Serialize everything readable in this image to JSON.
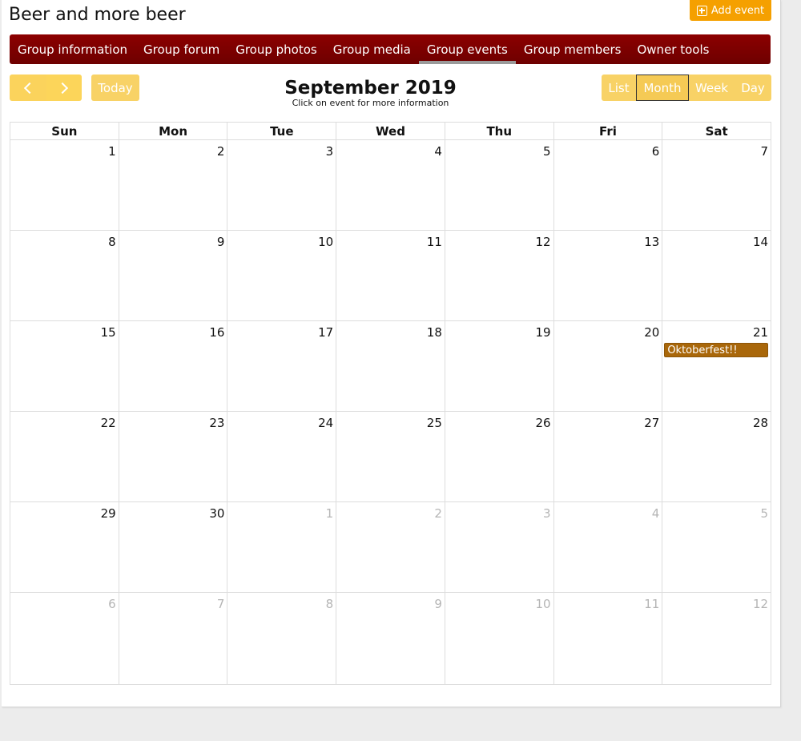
{
  "group": {
    "title": "Beer and more beer",
    "add_event_label": "Add event"
  },
  "nav": {
    "items": [
      {
        "label": "Group information"
      },
      {
        "label": "Group forum"
      },
      {
        "label": "Group photos"
      },
      {
        "label": "Group media"
      },
      {
        "label": "Group events",
        "active": true
      },
      {
        "label": "Group members"
      },
      {
        "label": "Owner tools"
      }
    ]
  },
  "toolbar": {
    "prev_icon": "chevron-left-icon",
    "next_icon": "chevron-right-icon",
    "today_label": "Today",
    "views": [
      "List",
      "Month",
      "Week",
      "Day"
    ],
    "active_view": "Month"
  },
  "calendar": {
    "title": "September 2019",
    "subtitle": "Click on event for more information",
    "weekdays": [
      "Sun",
      "Mon",
      "Tue",
      "Wed",
      "Thu",
      "Fri",
      "Sat"
    ],
    "weeks": [
      [
        {
          "d": "1"
        },
        {
          "d": "2"
        },
        {
          "d": "3"
        },
        {
          "d": "4"
        },
        {
          "d": "5"
        },
        {
          "d": "6"
        },
        {
          "d": "7"
        }
      ],
      [
        {
          "d": "8"
        },
        {
          "d": "9"
        },
        {
          "d": "10"
        },
        {
          "d": "11"
        },
        {
          "d": "12"
        },
        {
          "d": "13"
        },
        {
          "d": "14"
        }
      ],
      [
        {
          "d": "15"
        },
        {
          "d": "16"
        },
        {
          "d": "17"
        },
        {
          "d": "18"
        },
        {
          "d": "19"
        },
        {
          "d": "20"
        },
        {
          "d": "21",
          "event": "Oktoberfest!!"
        }
      ],
      [
        {
          "d": "22"
        },
        {
          "d": "23"
        },
        {
          "d": "24"
        },
        {
          "d": "25"
        },
        {
          "d": "26"
        },
        {
          "d": "27"
        },
        {
          "d": "28"
        }
      ],
      [
        {
          "d": "29"
        },
        {
          "d": "30"
        },
        {
          "d": "1",
          "other": true
        },
        {
          "d": "2",
          "other": true
        },
        {
          "d": "3",
          "other": true
        },
        {
          "d": "4",
          "other": true
        },
        {
          "d": "5",
          "other": true
        }
      ],
      [
        {
          "d": "6",
          "other": true
        },
        {
          "d": "7",
          "other": true
        },
        {
          "d": "8",
          "other": true
        },
        {
          "d": "9",
          "other": true
        },
        {
          "d": "10",
          "other": true
        },
        {
          "d": "11",
          "other": true
        },
        {
          "d": "12",
          "other": true
        }
      ]
    ]
  },
  "colors": {
    "nav_bg": "#7d0000",
    "button_yellow": "#f8d266",
    "add_event_orange": "#f5a000",
    "event_brown": "#a9670a"
  }
}
